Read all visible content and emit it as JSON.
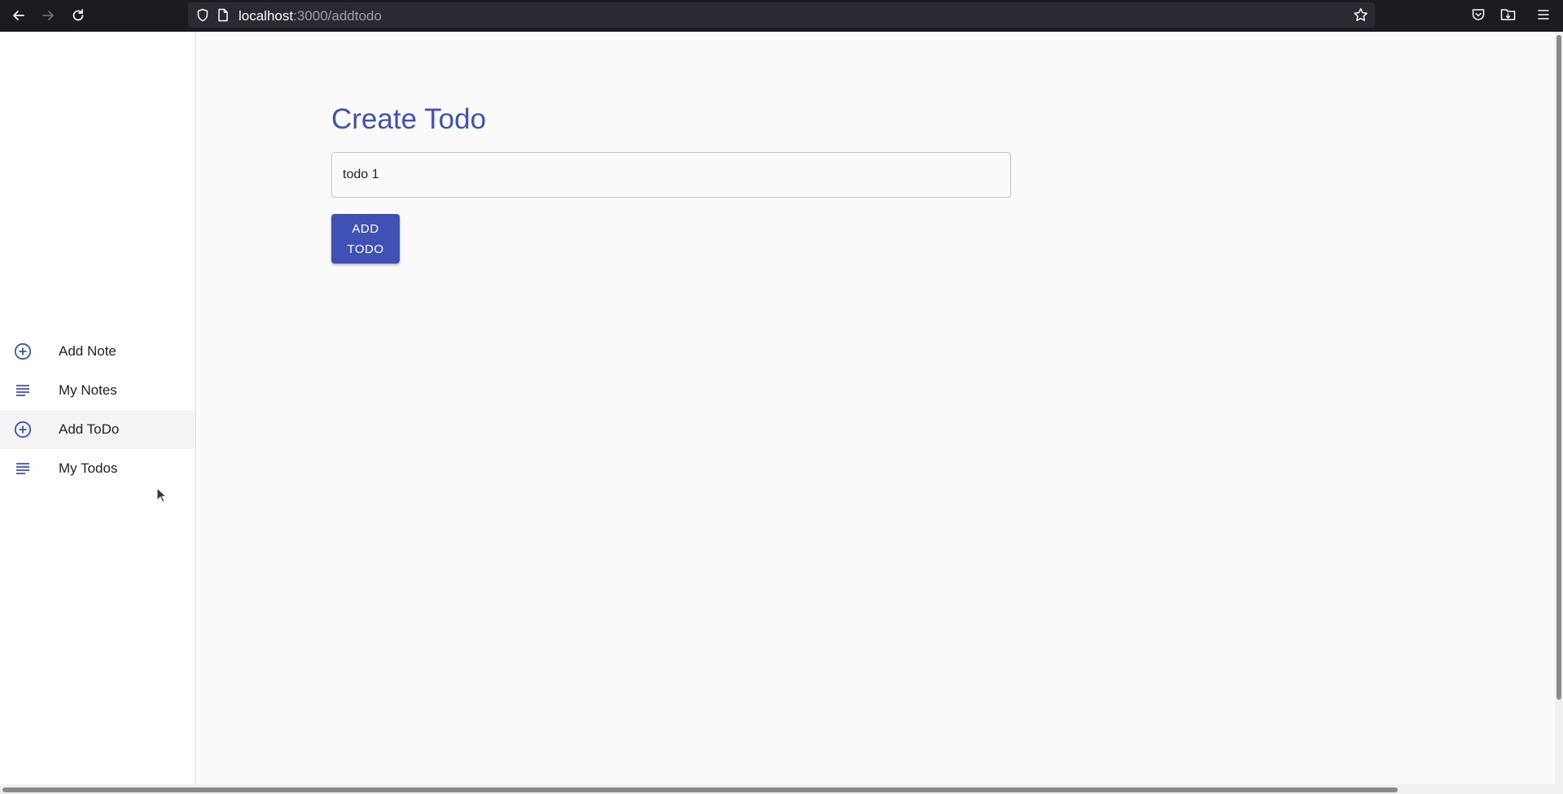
{
  "browser": {
    "url_host": "localhost",
    "url_path": ":3000/addtodo",
    "icons": [
      "back-icon",
      "forward-icon",
      "reload-icon",
      "shield-icon",
      "page-icon",
      "bookmark-star-icon",
      "pocket-icon",
      "downloads-folder-icon",
      "menu-icon"
    ]
  },
  "sidebar": {
    "items": [
      {
        "label": "Add Note",
        "icon": "add-circle-icon"
      },
      {
        "label": "My Notes",
        "icon": "subject-icon"
      },
      {
        "label": "Add ToDo",
        "icon": "add-circle-icon",
        "active": true
      },
      {
        "label": "My Todos",
        "icon": "subject-icon"
      }
    ]
  },
  "main": {
    "title": "Create Todo",
    "todo_input_value": "todo 1",
    "add_button_label": "ADD TODO"
  },
  "colors": {
    "accent": "#3f51b5",
    "toolbar_bg": "#1c1b22",
    "urlbar_bg": "#2b2a33",
    "page_bg": "#fafafa"
  }
}
